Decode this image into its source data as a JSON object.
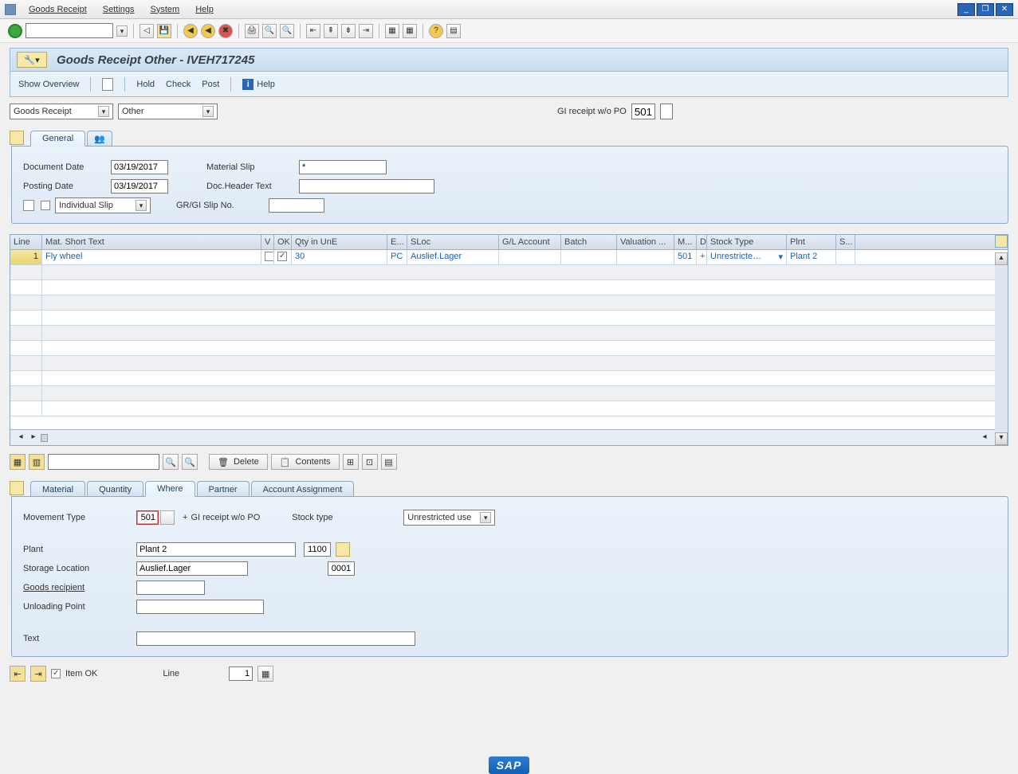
{
  "menu": {
    "goods_receipt": "Goods Receipt",
    "settings": "Settings",
    "system": "System",
    "help": "Help"
  },
  "title": "Goods Receipt Other - IVEH717245",
  "app_toolbar": {
    "show_overview": "Show Overview",
    "hold": "Hold",
    "check": "Check",
    "post": "Post",
    "help": "Help"
  },
  "sel": {
    "dd1": "Goods Receipt",
    "dd2": "Other",
    "gi_label": "GI receipt w/o PO",
    "gi_code": "501"
  },
  "general_tab": "General",
  "header": {
    "doc_date_label": "Document Date",
    "doc_date": "03/19/2017",
    "post_date_label": "Posting Date",
    "post_date": "03/19/2017",
    "slip_drop": "Individual Slip",
    "mat_slip_label": "Material Slip",
    "mat_slip": "*",
    "doc_hdr_label": "Doc.Header Text",
    "doc_hdr": "",
    "slipno_label": "GR/GI Slip No.",
    "slipno": ""
  },
  "grid": {
    "cols": {
      "line": "Line",
      "mat": "Mat. Short Text",
      "v": "V",
      "ok": "OK",
      "qty": "Qty in UnE",
      "eun": "E...",
      "sloc": "SLoc",
      "gl": "G/L Account",
      "batch": "Batch",
      "valtype": "Valuation ...",
      "m": "M...",
      "d": "D",
      "stock": "Stock Type",
      "plnt": "Plnt",
      "s": "S..."
    },
    "row": {
      "line": "1",
      "mat": "Fly wheel",
      "qty": "30",
      "eun": "PC",
      "sloc": "Auslief.Lager",
      "gl": "",
      "batch": "",
      "valtype": "",
      "m": "501",
      "d": "+",
      "stock": "Unrestricte…",
      "plnt": "Plant 2"
    }
  },
  "actions": {
    "delete": "Delete",
    "contents": "Contents"
  },
  "details": {
    "tabs": {
      "material": "Material",
      "quantity": "Quantity",
      "where": "Where",
      "partner": "Partner",
      "acct": "Account Assignment"
    },
    "movt_label": "Movement Type",
    "movt": "501",
    "movt_desc": "GI receipt w/o PO",
    "plus": "+",
    "stock_label": "Stock type",
    "stock": "Unrestricted use",
    "plant_label": "Plant",
    "plant": "Plant 2",
    "plant_code": "1100",
    "sloc_label": "Storage Location",
    "sloc": "Auslief.Lager",
    "sloc_code": "0001",
    "recip_label": "Goods recipient",
    "recip": "",
    "unload_label": "Unloading Point",
    "unload": "",
    "text_label": "Text",
    "text": ""
  },
  "foot": {
    "item_ok": "Item OK",
    "line_label": "Line",
    "line": "1"
  },
  "sap": "SAP"
}
